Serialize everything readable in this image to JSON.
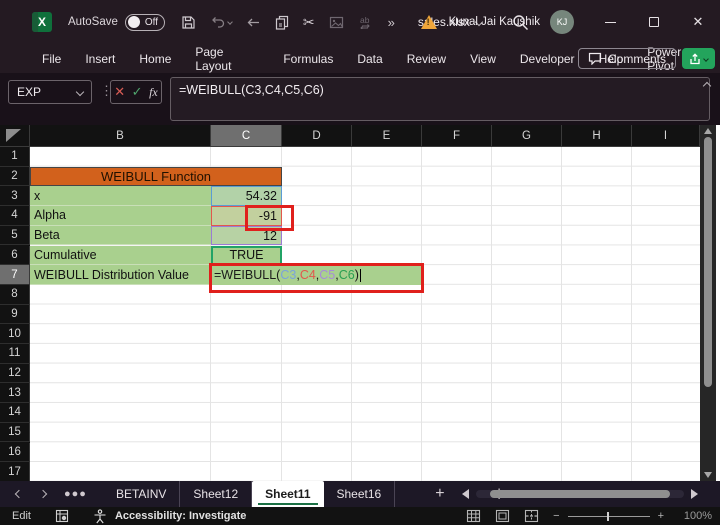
{
  "titlebar": {
    "autosave_label": "AutoSave",
    "autosave_state": "Off",
    "more_commands": "»",
    "filename": "sales.xlsx",
    "user_name": "Kunal Jai Kaushik",
    "user_initials": "KJ"
  },
  "menubar": {
    "items": [
      "File",
      "Insert",
      "Home",
      "Page Layout",
      "Formulas",
      "Data",
      "Review",
      "View",
      "Developer",
      "Help",
      "Power Pivot"
    ],
    "comments_label": "Comments"
  },
  "formula_bar": {
    "name_box": "EXP",
    "cancel_label": "✕",
    "enter_label": "✓",
    "fx_label": "fx",
    "formula": "=WEIBULL(C3,C4,C5,C6)"
  },
  "grid": {
    "columns": [
      "B",
      "C",
      "D",
      "E",
      "F",
      "G",
      "H",
      "I"
    ],
    "selected_column": "C",
    "row_numbers": [
      1,
      2,
      3,
      4,
      5,
      6,
      7,
      8,
      9,
      10,
      11,
      12,
      13,
      14,
      15,
      16,
      17
    ],
    "selected_row": 7,
    "title_cell": "WEIBULL Function",
    "rows": [
      {
        "label": "x",
        "value": "54.32"
      },
      {
        "label": "Alpha",
        "value": "-91"
      },
      {
        "label": "Beta",
        "value": "12"
      },
      {
        "label": "Cumulative",
        "value": "TRUE"
      },
      {
        "label": "WEIBULL Distribution Value",
        "value": ""
      }
    ],
    "formula_parts": [
      {
        "text": "=WEIBULL(",
        "color": "#1a1a1a"
      },
      {
        "text": "C3",
        "color": "#7ba2dc"
      },
      {
        "text": ",",
        "color": "#1a1a1a"
      },
      {
        "text": "C4",
        "color": "#e2574d"
      },
      {
        "text": ",",
        "color": "#1a1a1a"
      },
      {
        "text": "C5",
        "color": "#a78bd9"
      },
      {
        "text": ",",
        "color": "#1a1a1a"
      },
      {
        "text": "C6",
        "color": "#2aa052"
      },
      {
        "text": ")",
        "color": "#1a1a1a"
      }
    ]
  },
  "sheet_tabs": {
    "tabs": [
      {
        "label": "BETAINV",
        "active": false
      },
      {
        "label": "Sheet12",
        "active": false
      },
      {
        "label": "Sheet11",
        "active": true
      },
      {
        "label": "Sheet16",
        "active": false
      }
    ],
    "add_label": "+"
  },
  "status_bar": {
    "mode": "Edit",
    "accessibility": "Accessibility: Investigate",
    "zoom": "100%"
  },
  "colors": {
    "header_orange": "#d2611c",
    "cell_green": "#a9d08e",
    "accent_green": "#1a7044",
    "annotation_red": "#e0201c",
    "warning_yellow": "#f0a63a",
    "share_green": "#23a45c"
  }
}
